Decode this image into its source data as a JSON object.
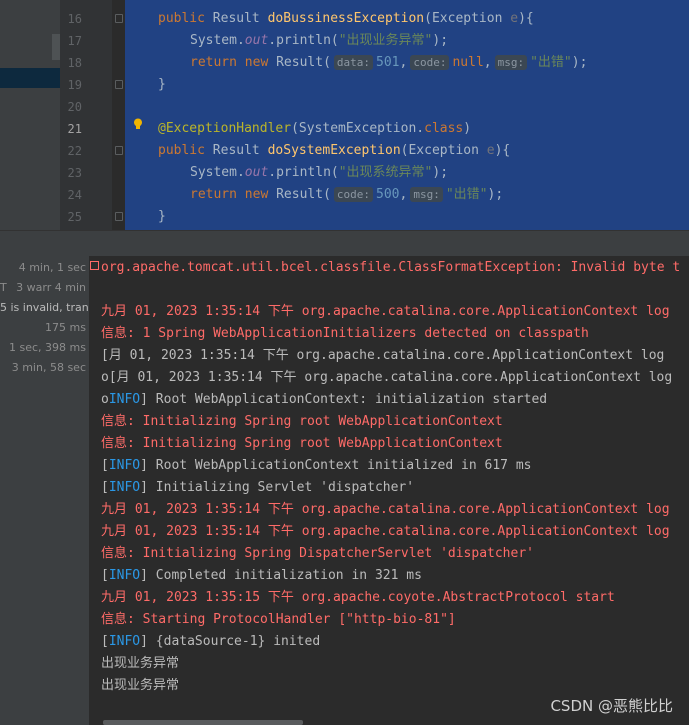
{
  "editor": {
    "lines": [
      {
        "num": "16",
        "seg": [
          [
            "Result",
            "kw",
            "public "
          ],
          [
            "",
            "",
            " "
          ]
        ]
      },
      {
        "num": "17"
      },
      {
        "num": "18"
      },
      {
        "num": "19"
      },
      {
        "num": "20"
      },
      {
        "num": "21"
      },
      {
        "num": "22"
      },
      {
        "num": "23"
      },
      {
        "num": "24"
      },
      {
        "num": "25"
      }
    ],
    "l16": {
      "public": "public",
      "type": "Result",
      "method": "doBussinessException",
      "open": "(",
      "ptype": "Exception",
      "pname": "e",
      "close": "){"
    },
    "l17": {
      "sys": "System.",
      "out": "out",
      "rest": ".println(",
      "str": "\"出现业务异常\"",
      "end": ");"
    },
    "l18": {
      "ret": "return",
      "nw": "new",
      "cls": "Result(",
      "h1": "data:",
      "v1": "501",
      "c1": ",",
      "h2": "code:",
      "v2": "null",
      "c2": ",",
      "h3": "msg:",
      "v3": "\"出错\"",
      "end": ");"
    },
    "l19": {
      "brace": "}"
    },
    "l21": {
      "ann": "@ExceptionHandler",
      "open": "(",
      "cls": "SystemException.",
      "kw": "class",
      "close": ")"
    },
    "l22": {
      "public": "public",
      "type": "Result",
      "method": "doSystemException",
      "open": "(",
      "ptype": "Exception",
      "pname": "e",
      "close": "){"
    },
    "l23": {
      "sys": "System.",
      "out": "out",
      "rest": ".println(",
      "str": "\"出现系统异常\"",
      "end": ");"
    },
    "l24": {
      "ret": "return",
      "nw": "new",
      "cls": "Result(",
      "h1": "code:",
      "v1": "500",
      "c1": ",",
      "h2": "msg:",
      "v2": "\"出错\"",
      "end": ");"
    },
    "l25": {
      "brace": "}"
    }
  },
  "tree": {
    "r1": "4 min, 1 sec",
    "r2a": "T",
    "r2b": "3 warr 4 min",
    "r3": "5 is invalid, trans",
    "r4": "175 ms",
    "r5": "1 sec, 398 ms",
    "r6": "3 min, 58 sec"
  },
  "console": {
    "c1": "org.apache.tomcat.util.bcel.classfile.ClassFormatException: Invalid byte t",
    "c2": "九月 01, 2023 1:35:14 下午 org.apache.catalina.core.ApplicationContext log",
    "c3": "信息: 1 Spring WebApplicationInitializers detected on classpath",
    "c4": "[月 01, 2023 1:35:14 下午 org.apache.catalina.core.ApplicationContext log",
    "c5": "o[月 01, 2023 1:35:14 下午 org.apache.catalina.core.ApplicationContext log",
    "c6a": "o",
    "c6b": "INFO",
    "c6c": "] Root WebApplicationContext: initialization started",
    "c7": "信息: Initializing Spring root WebApplicationContext",
    "c8": "信息: Initializing Spring root WebApplicationContext",
    "c9a": "[",
    "c9b": "INFO",
    "c9c": "] Root WebApplicationContext initialized in 617 ms",
    "c10a": "[",
    "c10b": "INFO",
    "c10c": "] Initializing Servlet 'dispatcher'",
    "c11": "九月 01, 2023 1:35:14 下午 org.apache.catalina.core.ApplicationContext log",
    "c12": "九月 01, 2023 1:35:14 下午 org.apache.catalina.core.ApplicationContext log",
    "c13": "信息: Initializing Spring DispatcherServlet 'dispatcher'",
    "c14a": "[",
    "c14b": "INFO",
    "c14c": "] Completed initialization in 321 ms",
    "c15": "九月 01, 2023 1:35:15 下午 org.apache.coyote.AbstractProtocol start",
    "c16": "信息: Starting ProtocolHandler [\"http-bio-81\"]",
    "c17a": "[",
    "c17b": "INFO",
    "c17c": "] {dataSource-1} inited",
    "c18": "出现业务异常",
    "c19": "出现业务异常"
  },
  "watermark": "CSDN @恶熊比比",
  "colors": {
    "selection": "#214283",
    "error": "#ff6b68",
    "info": "#2b98e6",
    "text": "#bbbbbb"
  }
}
